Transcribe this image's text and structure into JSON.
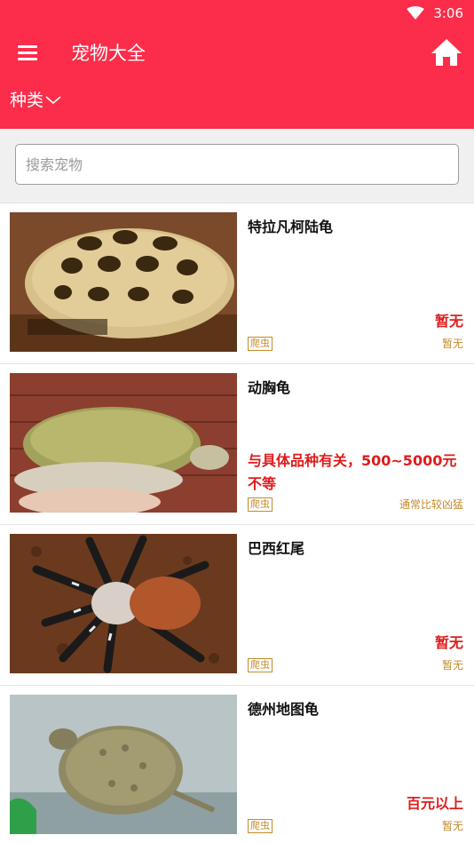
{
  "status": {
    "time": "3:06"
  },
  "app_bar": {
    "title": "宠物大全"
  },
  "filter": {
    "label": "种类"
  },
  "search": {
    "placeholder": "搜索宠物"
  },
  "colors": {
    "brand": "#fb2d4a",
    "price": "#e01b1b",
    "tag": "#c48a2a"
  },
  "items": [
    {
      "name": "特拉凡柯陆龟",
      "price": "暂无",
      "tag": "爬虫",
      "note": "暂无"
    },
    {
      "name": "动胸龟",
      "price": "与具体品种有关，500~5000元不等",
      "tag": "爬虫",
      "note": "通常比较凶猛"
    },
    {
      "name": "巴西红尾",
      "price": "暂无",
      "tag": "爬虫",
      "note": "暂无"
    },
    {
      "name": "德州地图龟",
      "price": "百元以上",
      "tag": "爬虫",
      "note": "暂无"
    }
  ]
}
